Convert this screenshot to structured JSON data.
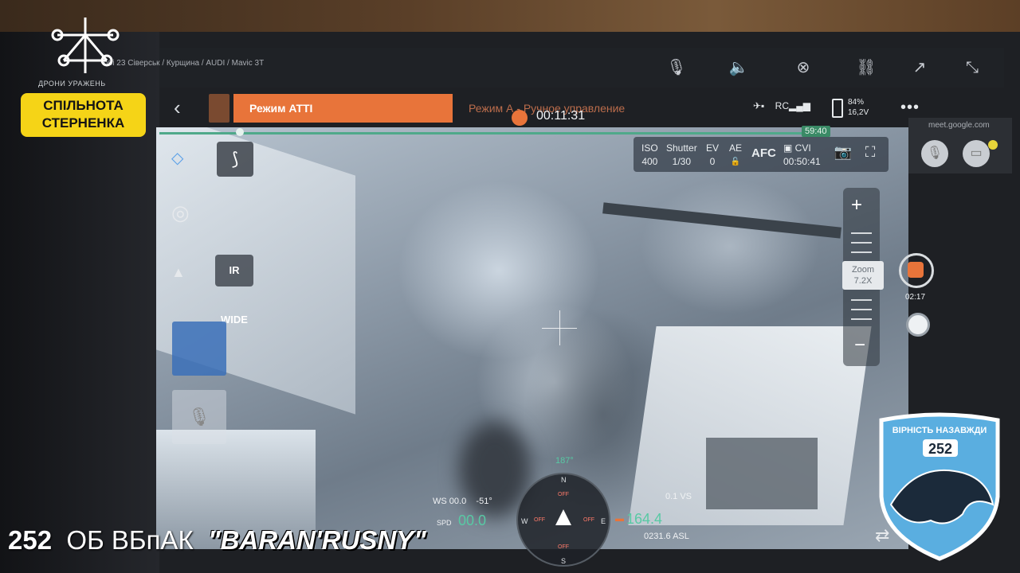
{
  "overlay": {
    "community_badge_line1": "СПІЛЬНОТА",
    "community_badge_line2": "СТЕРНЕНКА",
    "logo_subtitle": "ДРОНИ УРАЖЕНЬ",
    "caption_number": "252",
    "caption_unit": "ОБ  ВБпАК",
    "caption_nick": "\"BARAN'RUSNY\"",
    "shield_title": "ВІРНІСТЬ НАЗАВЖДИ",
    "shield_number": "252"
  },
  "window": {
    "path_title": "обі 23 Сіверськ / Курщина / AUDI / Mavic 3T"
  },
  "flight": {
    "mode_banner": "Режим ATTI",
    "mode_text": "Режим А - Ручное управление",
    "rec_timer": "00:11:31",
    "rc_label": "RC",
    "battery_percent": "84%",
    "battery_voltage": "16,2V",
    "more": "•••",
    "flight_time": "59:40"
  },
  "camera": {
    "iso_label": "ISO",
    "iso_value": "400",
    "shutter_label": "Shutter",
    "shutter_value": "1/30",
    "ev_label": "EV",
    "ev_value": "0",
    "ae_label": "AE",
    "ae_value": "🔓",
    "af_mode": "AFC",
    "storage_label": "CVI",
    "storage_time": "00:50:41",
    "zoom_label": "Zoom",
    "zoom_value": "7.2X",
    "rec_time": "02:17"
  },
  "left_tools": {
    "ir_label": "IR",
    "wide_label": "WIDE"
  },
  "meet": {
    "url": "meet.google.com"
  },
  "telemetry": {
    "ws": "WS 00.0",
    "ws_angle": "-51°",
    "spd_label": "SPD",
    "spd_value": "00.0",
    "heading": "187°",
    "vs": "0.1 VS",
    "alt_value": "164.4",
    "asl": "0231.6 ASL",
    "compass_off": "OFF",
    "compass_n": "N",
    "compass_s": "S",
    "compass_e": "E",
    "compass_w": "W"
  },
  "colors": {
    "accent_orange": "#e8743a",
    "badge_yellow": "#f5d417",
    "telemetry_green": "#58c9a4",
    "shield_blue": "#5aaee0"
  }
}
